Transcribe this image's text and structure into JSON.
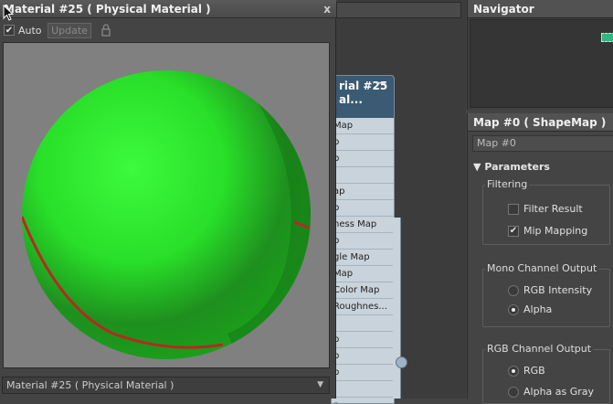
{
  "preview": {
    "title": "Material #25  ( Physical Material )",
    "close": "x",
    "auto_label": "Auto",
    "auto_checked": true,
    "update_label": "Update",
    "material_select": "Material #25  ( Physical Material )"
  },
  "node": {
    "title_line1": "rial #25",
    "title_line2": "al...",
    "slots": [
      "Map",
      "p",
      "p",
      "",
      "ap",
      "p",
      "ness Map",
      "p",
      "gle Map",
      "Map",
      "Color Map",
      "Roughnes...",
      "",
      "p",
      "p",
      "p",
      "",
      "p"
    ]
  },
  "navigator": {
    "title": "Navigator"
  },
  "map": {
    "title": "Map #0  ( ShapeMap )",
    "name_field": "Map #0",
    "params_label": "Parameters",
    "filtering": {
      "label": "Filtering",
      "filter_result": "Filter Result",
      "mip_mapping": "Mip Mapping"
    },
    "mono": {
      "label": "Mono Channel Output",
      "rgb_intensity": "RGB Intensity",
      "alpha": "Alpha"
    },
    "rgb": {
      "label": "RGB Channel Output",
      "rgb": "RGB",
      "alpha_as_gray": "Alpha as Gray"
    }
  },
  "colors": {
    "sphere": "#2fd82f",
    "stripe": "#b52a1f",
    "node_header": "#3b5a73"
  }
}
